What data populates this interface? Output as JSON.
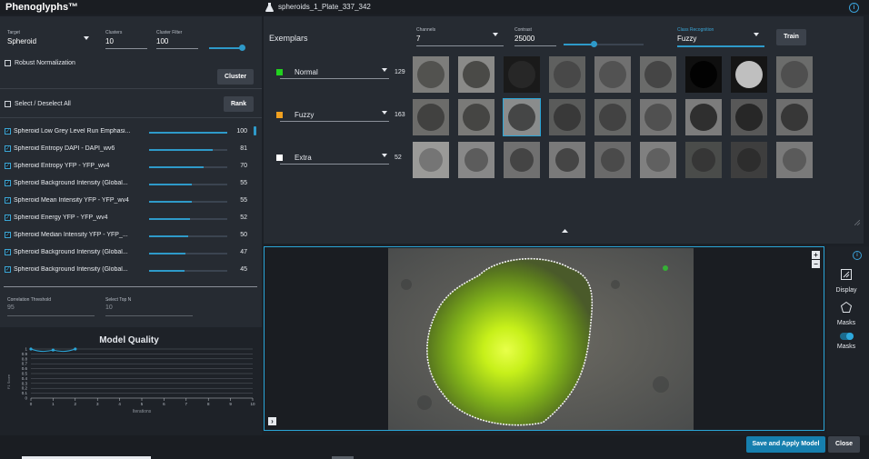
{
  "app": {
    "title": "Phenoglyphs™",
    "plate": "spheroids_1_Plate_337_342",
    "info_glyph": "i"
  },
  "settings": {
    "target": {
      "label": "Target",
      "value": "Spheroid"
    },
    "clusters": {
      "label": "Clusters",
      "value": "10"
    },
    "cluster_filter": {
      "label": "Cluster Filter",
      "value": "100"
    },
    "cluster_filter_slider_fraction": 0.95,
    "robust_normalization": "Robust Normalization",
    "cluster_button": "Cluster",
    "select_all": "Select / Deselect All",
    "rank_button": "Rank"
  },
  "features": [
    {
      "label": "Spheroid Low Grey Level Run Emphasi...",
      "value": "100",
      "fraction": 1.0
    },
    {
      "label": "Spheroid Entropy DAPI - DAPI_wv6",
      "value": "81",
      "fraction": 0.81
    },
    {
      "label": "Spheroid Entropy YFP - YFP_wv4",
      "value": "70",
      "fraction": 0.7
    },
    {
      "label": "Spheroid Background Intensity (Global...",
      "value": "55",
      "fraction": 0.55
    },
    {
      "label": "Spheroid Mean Intensity YFP - YFP_wv4",
      "value": "55",
      "fraction": 0.55
    },
    {
      "label": "Spheroid Energy YFP - YFP_wv4",
      "value": "52",
      "fraction": 0.52
    },
    {
      "label": "Spheroid Median Intensity YFP - YFP_...",
      "value": "50",
      "fraction": 0.5
    },
    {
      "label": "Spheroid Background Intensity (Global...",
      "value": "47",
      "fraction": 0.47
    },
    {
      "label": "Spheroid Background Intensity (Global...",
      "value": "45",
      "fraction": 0.45
    }
  ],
  "thresholds": {
    "correlation": {
      "label": "Correlation Threshold",
      "value": "95"
    },
    "top_n": {
      "label": "Select Top N",
      "value": "10"
    }
  },
  "chart_data": {
    "type": "line",
    "title": "Model Quality",
    "xlabel": "Iterations",
    "ylabel": "F1 Score",
    "x": [
      0,
      1,
      2
    ],
    "y": [
      1.0,
      0.98,
      1.0
    ],
    "xlim": [
      0,
      10
    ],
    "ylim": [
      0,
      1
    ],
    "xticks": [
      "0",
      "1",
      "2",
      "3",
      "4",
      "5",
      "6",
      "7",
      "8",
      "9",
      "10"
    ],
    "yticks": [
      "1",
      "0.9",
      "0.8",
      "0.7",
      "0.6",
      "0.5",
      "0.4",
      "0.3",
      "0.2",
      "0.1",
      "0"
    ],
    "grid": true,
    "color": "#2aa6d8"
  },
  "exemplars": {
    "title": "Exemplars",
    "channels": {
      "label": "Channels",
      "value": "7"
    },
    "contrast": {
      "label": "Contrast",
      "value": "25000"
    },
    "contrast_slider_fraction": 0.38,
    "class_recognition": {
      "label": "Class Recognition",
      "value": "Fuzzy"
    },
    "train_button": "Train",
    "classes": [
      {
        "name": "Normal",
        "count": "129",
        "color": "#22d11f"
      },
      {
        "name": "Fuzzy",
        "count": "163",
        "color": "#f0a020"
      },
      {
        "name": "Extra",
        "count": "52",
        "color": "#ffffff"
      }
    ]
  },
  "viewer": {
    "zoom_in": "+",
    "zoom_out": "−",
    "expand": "›"
  },
  "tools": {
    "display": "Display",
    "masks": "Masks",
    "masks_toggle": "Masks"
  },
  "footer": {
    "save_apply": "Save and Apply Model",
    "close": "Close"
  }
}
